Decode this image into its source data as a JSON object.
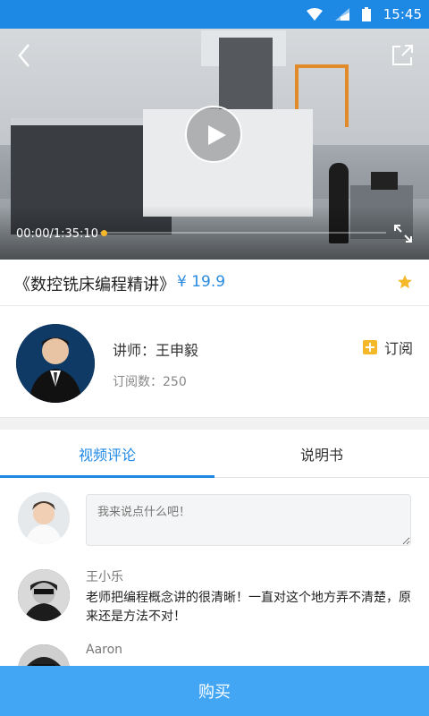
{
  "status_bar": {
    "time": "15:45"
  },
  "video": {
    "current_time": "00:00",
    "total_time": "1:35:10",
    "time_text": "00:00/1:35:10",
    "progress": 0.0
  },
  "course": {
    "title": "《数控铣床编程精讲》",
    "price": "¥ 19.9"
  },
  "teacher": {
    "name": "讲师：王申毅",
    "subscribers": "订阅数：250",
    "subscribe_label": "订阅"
  },
  "tabs": [
    {
      "label": "视频评论",
      "active": true
    },
    {
      "label": "说明书",
      "active": false
    }
  ],
  "comment_input": {
    "placeholder": "我来说点什么吧！"
  },
  "comments": [
    {
      "author": "王小乐",
      "text": "老师把编程概念讲的很清晰！一直对这个地方弄不清楚，原来还是方法不对！"
    },
    {
      "author": "Aaron",
      "text": ""
    }
  ],
  "buy_button": {
    "label": "购买"
  },
  "colors": {
    "primary": "#1e88e5",
    "buy_button": "#42a6f5",
    "accent_yellow": "#f5b829",
    "price": "#2b8be0"
  },
  "icons": [
    "back-icon",
    "share-icon",
    "play-icon",
    "fullscreen-icon",
    "star-icon",
    "plus-icon",
    "wifi-icon",
    "signal-icon",
    "battery-icon"
  ]
}
